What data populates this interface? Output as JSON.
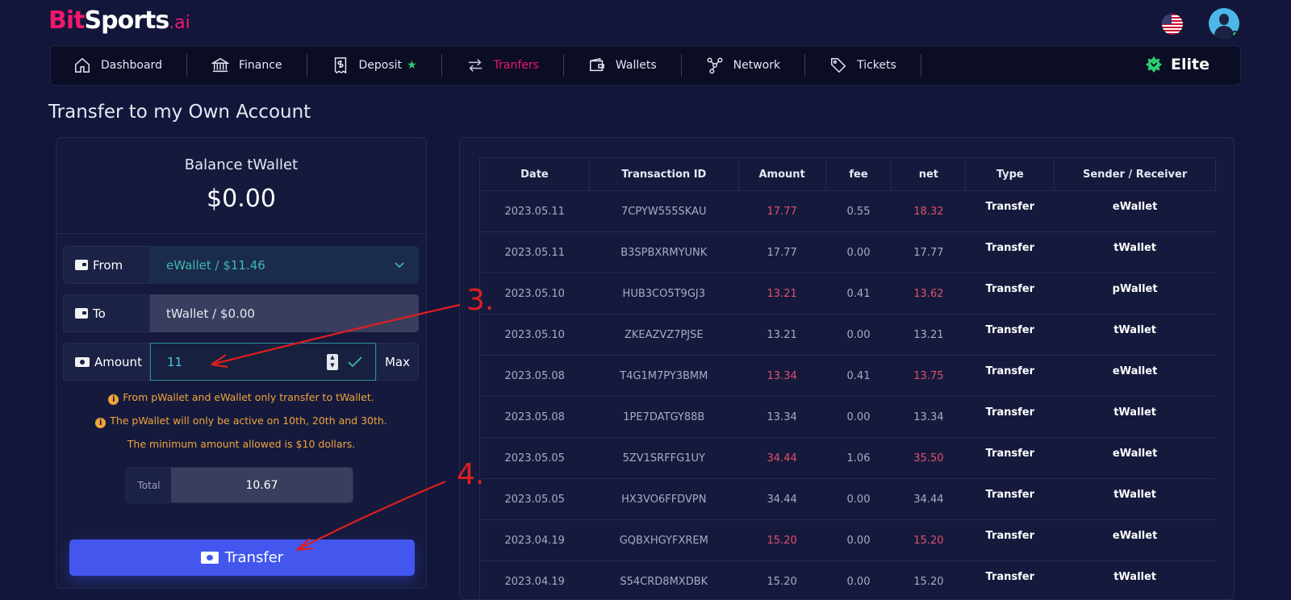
{
  "brand": {
    "bit": "Bit",
    "sports": "Sports",
    "ai": ".ai"
  },
  "nav": [
    {
      "label": "Dashboard",
      "icon": "home-icon"
    },
    {
      "label": "Finance",
      "icon": "bank-icon"
    },
    {
      "label": "Deposit",
      "icon": "receipt-dollar-icon",
      "badge": "★"
    },
    {
      "label": "Tranfers",
      "icon": "arrows-exchange-icon",
      "active": true
    },
    {
      "label": "Wallets",
      "icon": "wallet-icon"
    },
    {
      "label": "Network",
      "icon": "network-icon"
    },
    {
      "label": "Tickets",
      "icon": "tag-icon"
    }
  ],
  "elite": "Elite",
  "page_title": "Transfer to my Own Account",
  "balance": {
    "label": "Balance tWallet",
    "value": "$0.00"
  },
  "form": {
    "from_label": "From",
    "from_value": "eWallet / $11.46",
    "to_label": "To",
    "to_value": "tWallet / $0.00",
    "amount_label": "Amount",
    "amount_value": "11",
    "max_label": "Max"
  },
  "notes": [
    "From pWallet and eWallet only transfer to tWallet.",
    "The pWallet will only be active on 10th, 20th and 30th.",
    "The minimum amount allowed is $10 dollars."
  ],
  "total": {
    "label": "Total",
    "value": "10.67"
  },
  "transfer_button": "Transfer",
  "annotations": [
    "3.",
    "4."
  ],
  "colors": {
    "accent": "#f0196c",
    "primary": "#4357ef",
    "warning": "#f0a43a",
    "negative": "#e0506a",
    "teal": "#3fb8aa"
  },
  "table": {
    "headers": [
      "Date",
      "Transaction ID",
      "Amount",
      "fee",
      "net",
      "Type",
      "Sender / Receiver"
    ],
    "rows": [
      {
        "date": "2023.05.11",
        "id": "7CPYW555SKAU",
        "amount": "17.77",
        "fee": "0.55",
        "net": "18.32",
        "type": "Transfer",
        "who": "eWallet",
        "highlight": true
      },
      {
        "date": "2023.05.11",
        "id": "B3SPBXRMYUNK",
        "amount": "17.77",
        "fee": "0.00",
        "net": "17.77",
        "type": "Transfer",
        "who": "tWallet",
        "highlight": false
      },
      {
        "date": "2023.05.10",
        "id": "HUB3CO5T9GJ3",
        "amount": "13.21",
        "fee": "0.41",
        "net": "13.62",
        "type": "Transfer",
        "who": "pWallet",
        "highlight": true
      },
      {
        "date": "2023.05.10",
        "id": "ZKEAZVZ7PJSE",
        "amount": "13.21",
        "fee": "0.00",
        "net": "13.21",
        "type": "Transfer",
        "who": "tWallet",
        "highlight": false
      },
      {
        "date": "2023.05.08",
        "id": "T4G1M7PY3BMM",
        "amount": "13.34",
        "fee": "0.41",
        "net": "13.75",
        "type": "Transfer",
        "who": "eWallet",
        "highlight": true
      },
      {
        "date": "2023.05.08",
        "id": "1PE7DATGY88B",
        "amount": "13.34",
        "fee": "0.00",
        "net": "13.34",
        "type": "Transfer",
        "who": "tWallet",
        "highlight": false
      },
      {
        "date": "2023.05.05",
        "id": "5ZV1SRFFG1UY",
        "amount": "34.44",
        "fee": "1.06",
        "net": "35.50",
        "type": "Transfer",
        "who": "eWallet",
        "highlight": true
      },
      {
        "date": "2023.05.05",
        "id": "HX3VO6FFDVPN",
        "amount": "34.44",
        "fee": "0.00",
        "net": "34.44",
        "type": "Transfer",
        "who": "tWallet",
        "highlight": false
      },
      {
        "date": "2023.04.19",
        "id": "GQBXHGYFXREM",
        "amount": "15.20",
        "fee": "0.00",
        "net": "15.20",
        "type": "Transfer",
        "who": "eWallet",
        "highlight": true
      },
      {
        "date": "2023.04.19",
        "id": "S54CRD8MXDBK",
        "amount": "15.20",
        "fee": "0.00",
        "net": "15.20",
        "type": "Transfer",
        "who": "tWallet",
        "highlight": false
      }
    ]
  }
}
